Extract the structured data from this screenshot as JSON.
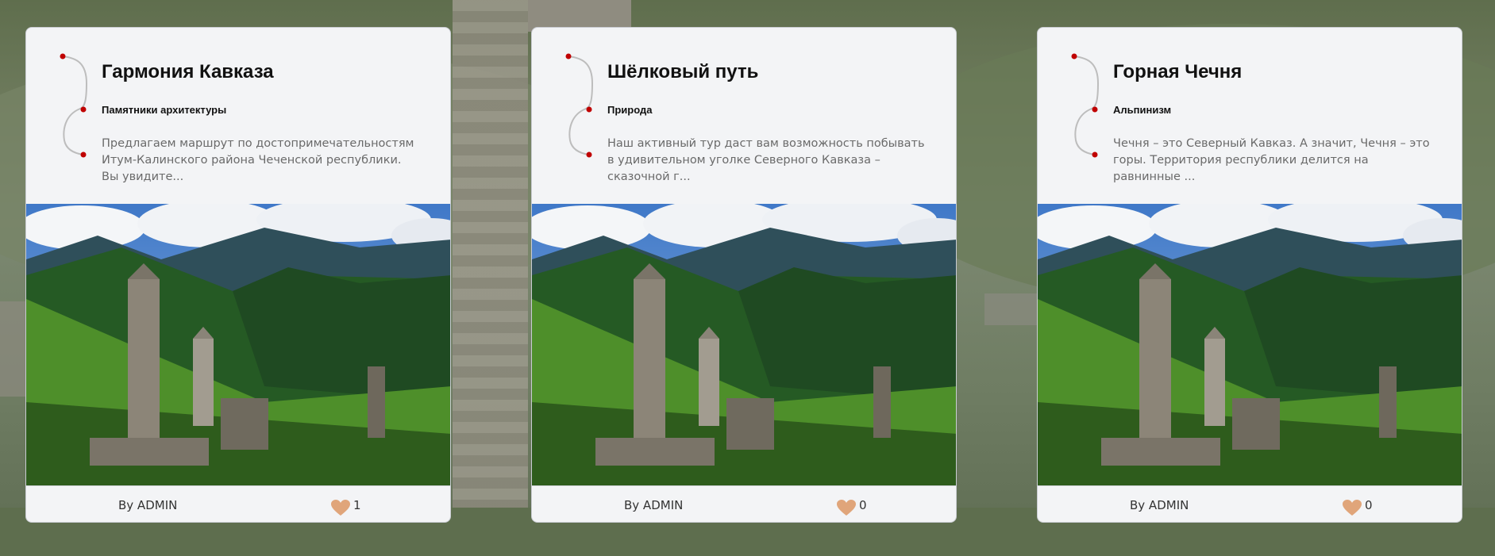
{
  "colors": {
    "route_dot": "#c00000",
    "heart": "#e0a57a",
    "card_bg": "#f3f4f6"
  },
  "cards": [
    {
      "title": "Гармония Кавказа",
      "category": "Памятники архитектуры",
      "description": "Предлагаем маршрут по достопримечательностям Итум-Калинского района Чеченской республики. Вы увидите...",
      "author": "By ADMIN",
      "likes": "1",
      "image_name": "chechen-towers-landscape"
    },
    {
      "title": "Шёлковый путь",
      "category": "Природа",
      "description": "Наш активный тур даст вам возможность побывать в удивительном уголке Северного Кавказа – сказочной г...",
      "author": "By ADMIN",
      "likes": "0",
      "image_name": "chechen-towers-landscape"
    },
    {
      "title": "Горная Чечня",
      "category": "Альпинизм",
      "description": "Чечня – это Северный Кавказ. А значит, Чечня – это горы. Территория республики делится на равнинные ...",
      "author": "By ADMIN",
      "likes": "0",
      "image_name": "chechen-towers-landscape"
    }
  ]
}
